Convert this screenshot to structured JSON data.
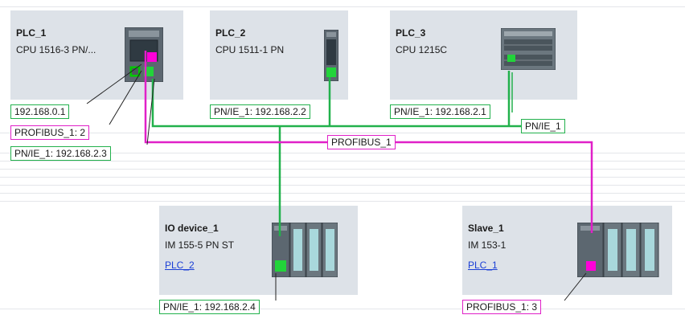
{
  "devices": [
    {
      "name": "PLC_1",
      "type": "CPU 1516-3 PN/...",
      "link": ""
    },
    {
      "name": "PLC_2",
      "type": "CPU 1511-1 PN",
      "link": ""
    },
    {
      "name": "PLC_3",
      "type": "CPU 1215C",
      "link": ""
    },
    {
      "name": "IO device_1",
      "type": "IM 155-5 PN ST",
      "link": "PLC_2"
    },
    {
      "name": "Slave_1",
      "type": "IM 153-1",
      "link": "PLC_1"
    }
  ],
  "labels": {
    "plc1_ip": "192.168.0.1",
    "plc1_profibus": "PROFIBUS_1: 2",
    "plc1_pnie": "PN/IE_1: 192.168.2.3",
    "plc2_pnie": "PN/IE_1: 192.168.2.2",
    "plc3_pnie": "PN/IE_1: 192.168.2.1",
    "network_pnie": "PN/IE_1",
    "network_profibus": "PROFIBUS_1",
    "io_device_pnie": "PN/IE_1: 192.168.2.4",
    "slave_profibus": "PROFIBUS_1: 3"
  },
  "colors": {
    "profinet": "#22b14c",
    "profibus": "#e020c8",
    "device_bg": "#dde2e8",
    "link": "#1a3fd6"
  }
}
